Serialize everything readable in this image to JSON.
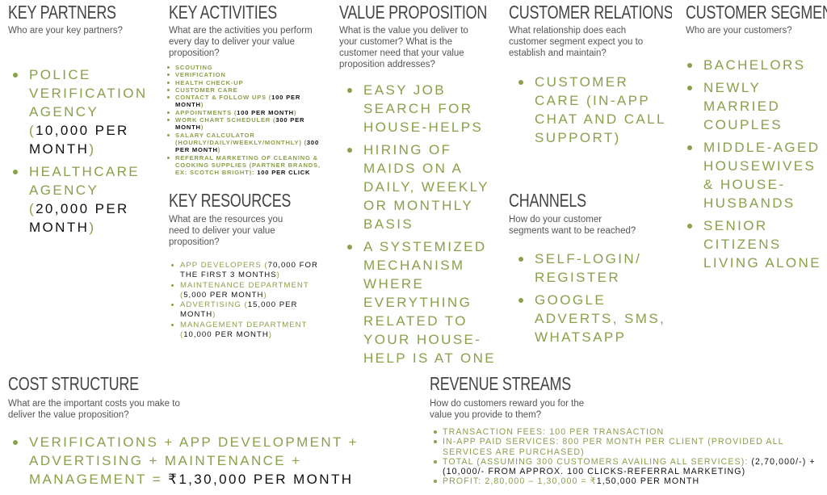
{
  "colors": {
    "accent": "#8aa04a",
    "highlight": "#111111",
    "border": "#3a3a3a",
    "title": "#444444"
  },
  "blocks": {
    "key_partners": {
      "title": "KEY PARTNERS",
      "question": "Who are your key partners?",
      "items": [
        [
          {
            "t": "Police verification agency ("
          },
          {
            "t": "10,000 per month",
            "dk": true
          },
          {
            "t": ")"
          }
        ],
        [
          {
            "t": "Healthcare agency ("
          },
          {
            "t": "20,000 per month",
            "dk": true
          },
          {
            "t": ")"
          }
        ]
      ]
    },
    "key_activities": {
      "title": "KEY ACTIVITIES",
      "question": "What are the activities you perform every day to deliver your value proposition?",
      "items": [
        [
          {
            "t": "Scouting"
          }
        ],
        [
          {
            "t": "Verification"
          }
        ],
        [
          {
            "t": "Health check-up"
          }
        ],
        [
          {
            "t": "Customer care"
          }
        ],
        [
          {
            "t": "Contact & follow ups ("
          },
          {
            "t": "100 per month",
            "dk": true
          },
          {
            "t": ")"
          }
        ],
        [
          {
            "t": "Appointments ("
          },
          {
            "t": "100 per month",
            "dk": true
          },
          {
            "t": ")"
          }
        ],
        [
          {
            "t": "Work chart scheduler ("
          },
          {
            "t": "300 per month",
            "dk": true
          },
          {
            "t": ")"
          }
        ],
        [
          {
            "t": "Salary calculator (hourly/daily/weekly/monthly) ("
          },
          {
            "t": "300 per month",
            "dk": true
          },
          {
            "t": ")"
          }
        ],
        [
          {
            "t": "Referral marketing of cleaning & cooking supplies (partner brands, ex: scotch bright): "
          },
          {
            "t": "100 per click",
            "dk": true
          }
        ]
      ]
    },
    "key_resources": {
      "title": "KEY RESOURCES",
      "question": "What are the resources you need to deliver your value proposition?",
      "items": [
        [
          {
            "t": "App developers ("
          },
          {
            "t": "70,000 for the first 3 months",
            "dk": true
          },
          {
            "t": ")"
          }
        ],
        [
          {
            "t": "Maintenance department ("
          },
          {
            "t": "5,000 per month",
            "dk": true
          },
          {
            "t": ")"
          }
        ],
        [
          {
            "t": "Advertising ("
          },
          {
            "t": "15,000 per month",
            "dk": true
          },
          {
            "t": ")"
          }
        ],
        [
          {
            "t": "Management department ("
          },
          {
            "t": "10,000 per month",
            "dk": true
          },
          {
            "t": ")"
          }
        ]
      ]
    },
    "value_proposition": {
      "title": "VALUE PROPOSITION",
      "question": "What is the value you deliver to your customer? What is the customer need that your value proposition addresses?",
      "items": [
        [
          {
            "t": "Easy job search for house-helps"
          }
        ],
        [
          {
            "t": "Hiring of maids on a daily, weekly or monthly basis"
          }
        ],
        [
          {
            "t": "A systemized mechanism where everything related to your house-help is at one place"
          }
        ]
      ]
    },
    "customer_relationships": {
      "title": "CUSTOMER RELATIONSHIPS",
      "question": "What relationship does each customer segment expect you to establish and maintain?",
      "items": [
        [
          {
            "t": "Customer care (in-app chat and call support)"
          }
        ]
      ]
    },
    "channels": {
      "title": "CHANNELS",
      "question": "How do your customer segments want to be reached?",
      "items": [
        [
          {
            "t": "Self-login/ register"
          }
        ],
        [
          {
            "t": "Google adverts, SMS, WhatsApp"
          }
        ]
      ]
    },
    "customer_segments": {
      "title": "CUSTOMER SEGMENTS",
      "question": "Who are your customers?",
      "items": [
        [
          {
            "t": "Bachelors"
          }
        ],
        [
          {
            "t": "Newly married couples"
          }
        ],
        [
          {
            "t": "Middle-aged housewives & house-husbands"
          }
        ],
        [
          {
            "t": "Senior citizens living alone"
          }
        ]
      ]
    },
    "cost_structure": {
      "title": "COST STRUCTURE",
      "question": "What are the important costs you make to deliver the value proposition?",
      "items": [
        [
          {
            "t": "Verifications + App development + advertising + maintenance + management = "
          },
          {
            "t": "₹1,30,000 per month",
            "dk": true
          }
        ]
      ]
    },
    "revenue_streams": {
      "title": "REVENUE STREAMS",
      "question": "How do customers reward you for the value you provide to them?",
      "items": [
        [
          {
            "t": "Transaction fees: 100 per transaction"
          }
        ],
        [
          {
            "t": "In-app paid services: 800 per month per client (provided all services are purchased)"
          }
        ],
        [
          {
            "t": "Total (assuming 300 customers availing all services): "
          },
          {
            "t": "(2,70,000/-) + (10,000/- from approx. 100 clicks-referral marketing)",
            "dk": true
          }
        ],
        [
          {
            "t": "Profit: 2,80,000 – 1,30,000 = ₹"
          },
          {
            "t": "1,50,000 per month",
            "dk": true
          }
        ]
      ]
    }
  }
}
